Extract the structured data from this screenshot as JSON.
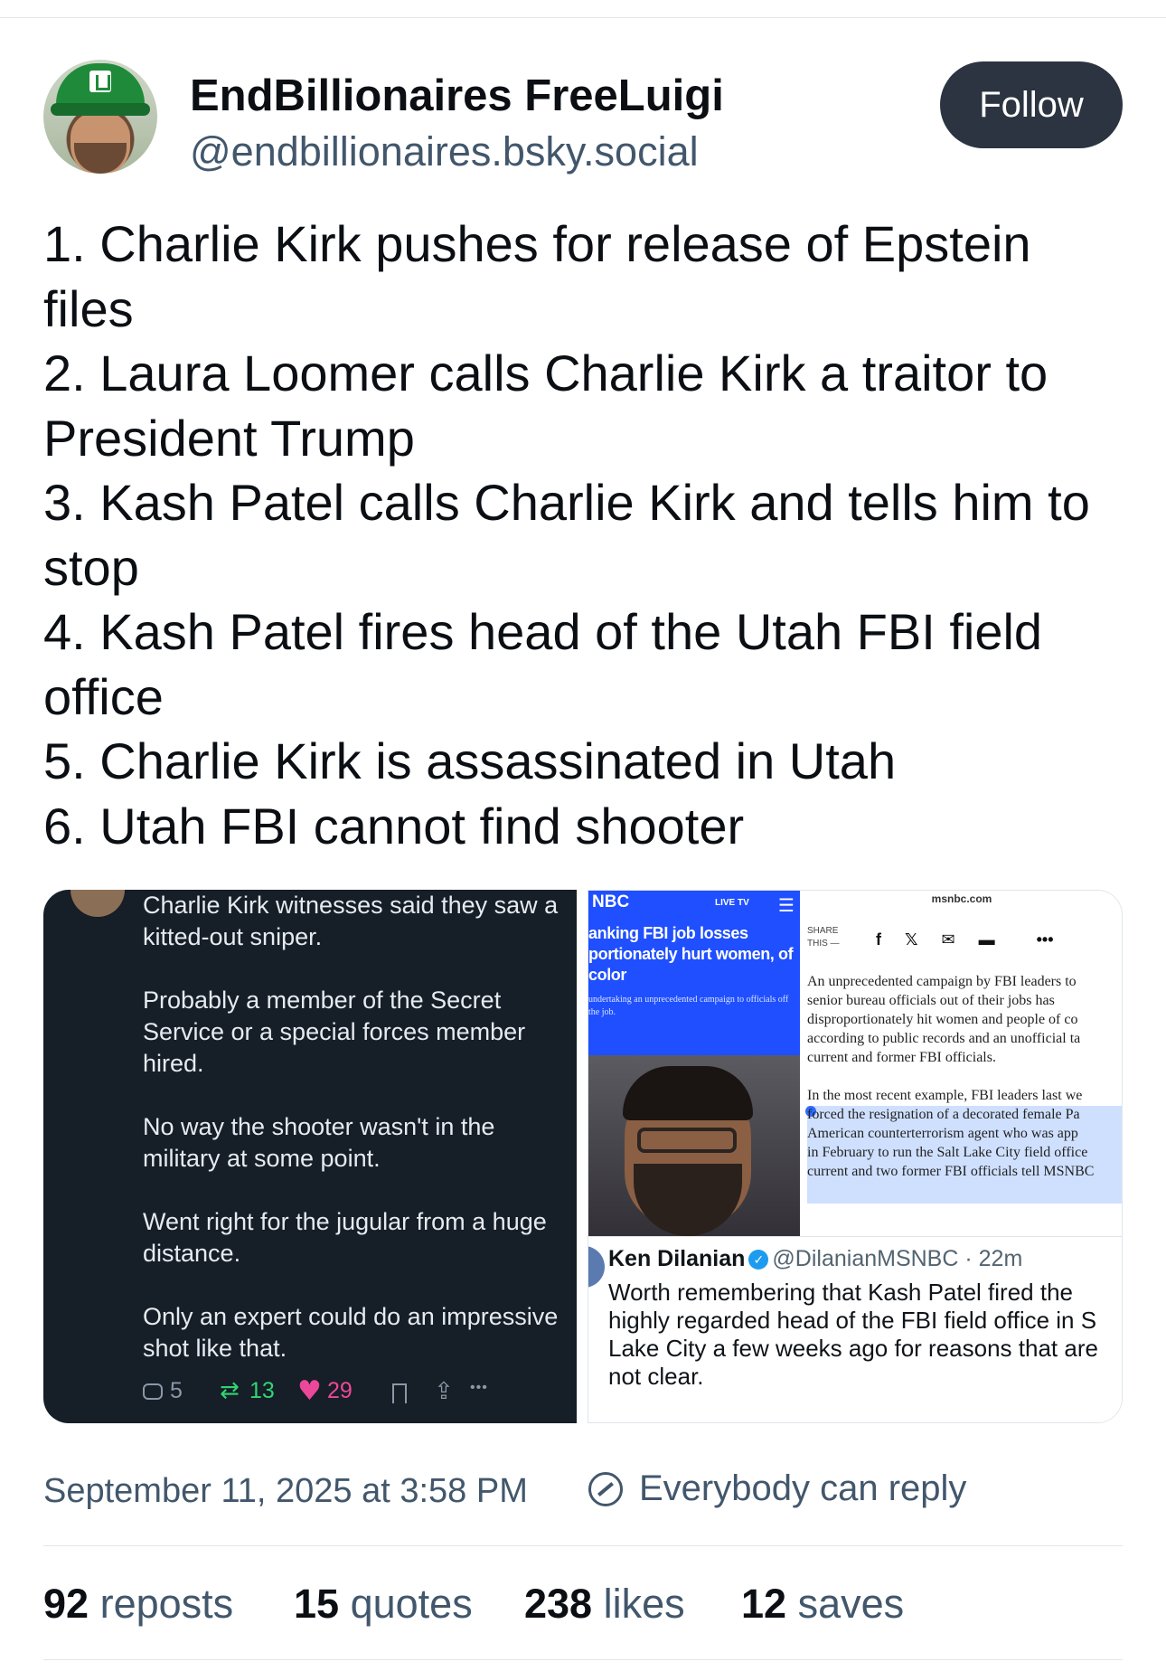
{
  "author": {
    "display_name": "EndBillionaires FreeLuigi",
    "handle": "@endbillionaires.bsky.social",
    "follow_label": "Follow"
  },
  "post": {
    "lines": [
      "1. Charlie Kirk pushes for release of Epstein",
      "files",
      "2. Laura Loomer calls Charlie Kirk a traitor to",
      "President Trump",
      "3. Kash Patel calls Charlie Kirk and tells him to",
      "stop",
      "4. Kash Patel fires head of the Utah FBI field",
      "office",
      "5. Charlie Kirk is assassinated in Utah",
      "6. Utah FBI cannot find shooter"
    ]
  },
  "image_left": {
    "paragraphs": [
      "Charlie Kirk witnesses said they saw a kitted-out sniper.",
      "Probably a member of the Secret Service or a special forces member hired.",
      "No way the shooter wasn't in the military at some point.",
      "Went right for the jugular from a huge distance.",
      "Only an expert could do an impressive shot like that."
    ],
    "actions": {
      "replies": "5",
      "reposts": "13",
      "likes": "29"
    }
  },
  "image_right": {
    "nbc_logo": "NBC",
    "live_label": "LIVE TV",
    "headline": "anking FBI job losses portionately hurt women, of color",
    "dek": "undertaking an unprecedented campaign to officials off the job.",
    "domain": "msnbc.com",
    "share_label": "SHARE THIS —",
    "article": [
      "An unprecedented campaign by FBI leaders to",
      "senior bureau officials out of their jobs has",
      "disproportionately hit women and people of co",
      "according to public records and an unofficial ta",
      "current and former FBI officials.",
      "",
      "In the most recent example, FBI leaders last we",
      "forced the resignation of a decorated female Pa",
      "American counterterrorism agent who was app",
      "in February to run the Salt Lake City field office",
      "current and two former FBI officials tell MSNBC"
    ],
    "tweet": {
      "name": "Ken Dilanian",
      "handle": "@DilanianMSNBC",
      "time": "22m",
      "lines": [
        "Worth remembering that Kash Patel fired the",
        "highly regarded head of the FBI field office in S",
        "Lake City a few weeks ago for reasons that are",
        "not clear."
      ]
    }
  },
  "footer": {
    "timestamp": "September 11, 2025 at 3:58 PM",
    "reply_scope": "Everybody can reply",
    "stats": [
      {
        "num": "92",
        "label": "reposts"
      },
      {
        "num": "15",
        "label": "quotes"
      },
      {
        "num": "238",
        "label": "likes"
      },
      {
        "num": "12",
        "label": "saves"
      }
    ]
  },
  "colors": {
    "follow_button": "#2b3440",
    "dark_card": "#161e27",
    "repost_green": "#2fd673",
    "like_pink": "#ec4899",
    "nbc_blue": "#1f4fff",
    "muted_text": "#42576c"
  }
}
